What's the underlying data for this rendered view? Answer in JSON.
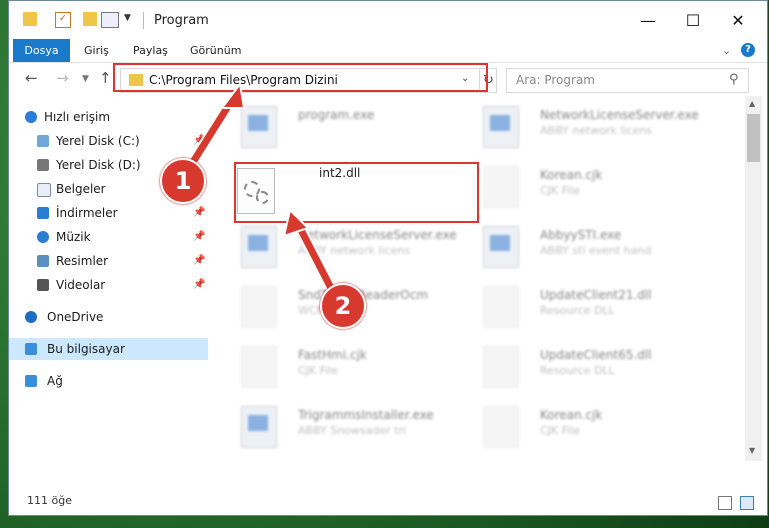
{
  "window": {
    "title": "Program",
    "controls": {
      "minimize": "—",
      "maximize": "☐",
      "close": "✕"
    }
  },
  "ribbon": {
    "tabs": [
      "Dosya",
      "Giriş",
      "Paylaş",
      "Görünüm"
    ]
  },
  "address_bar": {
    "path": "C:\\Program Files\\Program Dizini",
    "search_placeholder": "Ara: Program"
  },
  "sidebar": {
    "items": [
      {
        "label": "Hızlı erişim",
        "icon": "star-icon",
        "pinned": false
      },
      {
        "label": "Yerel Disk (C:)",
        "icon": "drive-icon",
        "pinned": true
      },
      {
        "label": "Yerel Disk (D:)",
        "icon": "drive-icon",
        "pinned": false
      },
      {
        "label": "Belgeler",
        "icon": "documents-icon",
        "pinned": true
      },
      {
        "label": "İndirmeler",
        "icon": "download-icon",
        "pinned": true
      },
      {
        "label": "Müzik",
        "icon": "music-icon",
        "pinned": true
      },
      {
        "label": "Resimler",
        "icon": "pictures-icon",
        "pinned": true
      },
      {
        "label": "Videolar",
        "icon": "video-icon",
        "pinned": true
      },
      {
        "label": "OneDrive",
        "icon": "cloud-icon",
        "pinned": false
      },
      {
        "label": "Bu bilgisayar",
        "icon": "computer-icon",
        "pinned": false,
        "selected": true
      },
      {
        "label": "Ağ",
        "icon": "network-icon",
        "pinned": false
      }
    ]
  },
  "files": {
    "left": [
      {
        "name": "program.exe",
        "desc": "",
        "type": "exe"
      },
      {
        "name": "int2.dll",
        "desc": "",
        "type": "dll",
        "highlighted": true
      },
      {
        "name": "NetworkLicenseServer.exe",
        "desc": "ABBY network licens",
        "type": "exe"
      },
      {
        "name": "SndToFineReaderOcm",
        "desc": "WCM File",
        "type": "blank"
      },
      {
        "name": "FastHmi.cjk",
        "desc": "CJK File",
        "type": "blank"
      },
      {
        "name": "TrigrammsInstaller.exe",
        "desc": "ABBY Snowsader tri",
        "type": "exe"
      }
    ],
    "right": [
      {
        "name": "NetworkLicenseServer.exe",
        "desc": "ABBY network licens",
        "type": "exe"
      },
      {
        "name": "Korean.cjk",
        "desc": "CJK File",
        "type": "blank"
      },
      {
        "name": "AbbyySTI.exe",
        "desc": "ABBY sti event hand",
        "type": "exe"
      },
      {
        "name": "UpdateClient21.dll",
        "desc": "Resource DLL",
        "type": "gear"
      },
      {
        "name": "UpdateClient65.dll",
        "desc": "Resource DLL",
        "type": "gear"
      },
      {
        "name": "Korean.cjk",
        "desc": "CJK File",
        "type": "blank"
      }
    ]
  },
  "status": {
    "count_text": "111 öğe"
  },
  "callouts": [
    "1",
    "2"
  ],
  "colors": {
    "accent": "#1979ca",
    "highlight": "#dd3333",
    "selection": "#cce8ff"
  }
}
